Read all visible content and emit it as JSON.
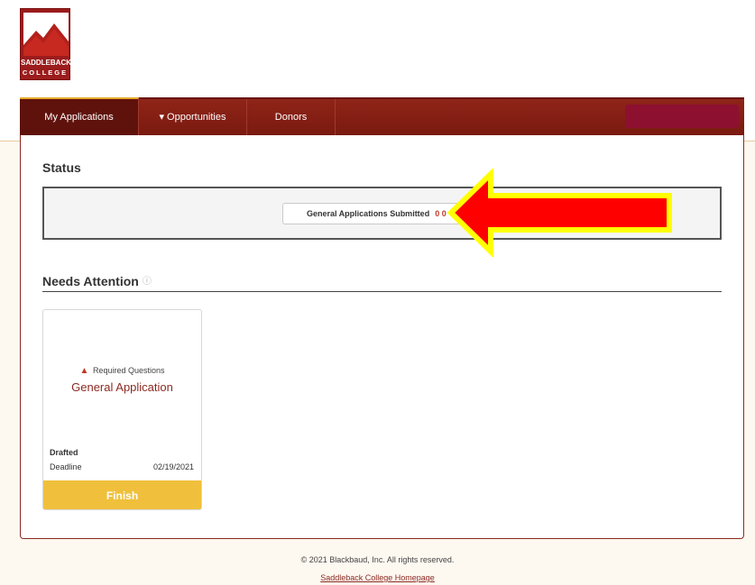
{
  "logo": {
    "line1": "SADDLEBACK",
    "line2": "COLLEGE"
  },
  "nav": {
    "tabs": [
      {
        "label": "My Applications",
        "active": true
      },
      {
        "label": "▾ Opportunities",
        "active": false
      },
      {
        "label": "Donors",
        "active": false
      }
    ]
  },
  "status": {
    "title": "Status",
    "chip_label": "General Applications Submitted",
    "chip_count": "0 0"
  },
  "needs_attention": {
    "title": "Needs Attention",
    "info_icon": "ⓘ",
    "card": {
      "warning_icon": "▲",
      "warning_label": "Required Questions",
      "application_name": "General Application",
      "state": "Drafted",
      "deadline_label": "Deadline",
      "deadline_date": "02/19/2021",
      "button_label": "Finish"
    }
  },
  "footer": {
    "copyright": "© 2021 Blackbaud, Inc. All rights reserved.",
    "link": "Saddleback College Homepage"
  },
  "colors": {
    "nav_bg": "#7a1a10",
    "accent": "#f0c03c",
    "arrow_fill": "#ff0000",
    "arrow_outline": "#ffff00"
  }
}
